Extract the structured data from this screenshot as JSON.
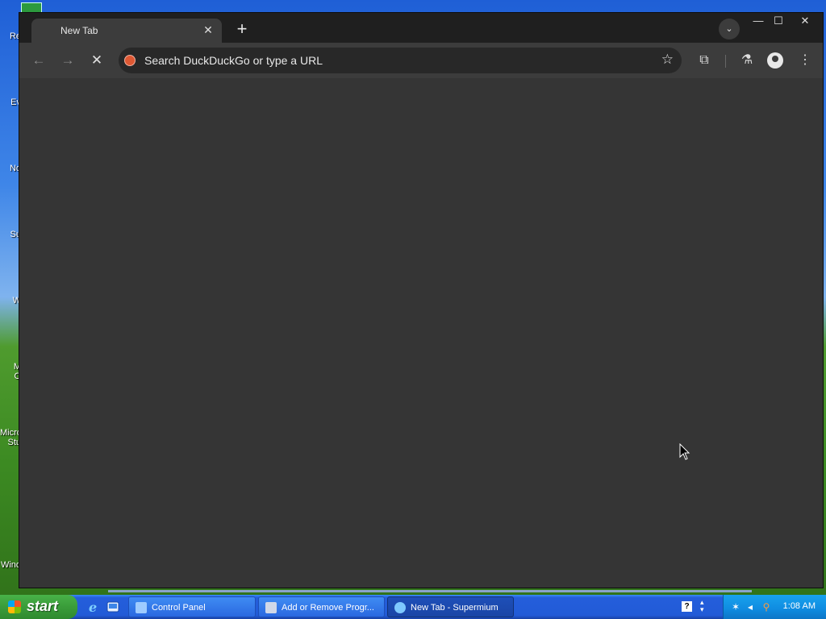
{
  "desktop": {
    "icon_labels": [
      "Re",
      "Ev",
      "No",
      "Su",
      "W",
      "M",
      "O",
      "Micro",
      "Stu",
      "Wind"
    ]
  },
  "browser": {
    "tab": {
      "title": "New Tab",
      "close_glyph": "✕"
    },
    "new_tab_glyph": "+",
    "tab_search_glyph": "⌄",
    "window_controls": {
      "minimize": "—",
      "maximize": "☐",
      "close": "✕"
    },
    "nav": {
      "back_glyph": "←",
      "forward_glyph": "→",
      "stop_glyph": "✕"
    },
    "omnibox": {
      "placeholder": "Search DuckDuckGo or type a URL",
      "star_glyph": "☆"
    },
    "toolbar_icons": {
      "extensions_glyph": "⧉",
      "labs_glyph": "⚗",
      "menu_glyph": "⋮"
    }
  },
  "taskbar": {
    "start_label": "start",
    "tasks": [
      {
        "label": "Control Panel",
        "state": "inactive",
        "icon_color": "#9ecbff"
      },
      {
        "label": "Add or Remove Progr...",
        "state": "inactive",
        "icon_color": "#d0d8e8"
      },
      {
        "label": "New Tab - Supermium",
        "state": "active",
        "icon_color": "#7ec8ff"
      }
    ],
    "help_glyph": "?",
    "clock": "1:08 AM"
  },
  "colors": {
    "window_bg": "#1f1f1f",
    "toolbar_bg": "#3c3c3c",
    "content_bg": "#353535",
    "ddg_orange": "#de5833"
  }
}
